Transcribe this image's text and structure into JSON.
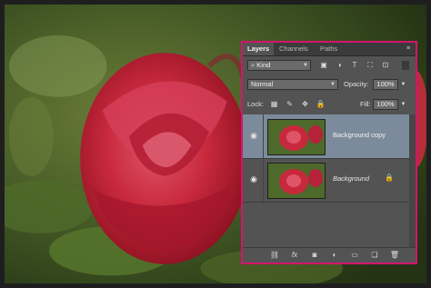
{
  "panel": {
    "tabs": [
      "Layers",
      "Channels",
      "Paths"
    ],
    "active_tab": "Layers",
    "menu_icon": "panel-menu-icon"
  },
  "filter": {
    "kind_label": "Kind",
    "icons": [
      "image-filter-icon",
      "adjustment-filter-icon",
      "type-filter-icon",
      "shape-filter-icon",
      "smart-object-filter-icon"
    ]
  },
  "blend": {
    "mode": "Normal",
    "opacity_label": "Opacity:",
    "opacity_value": "100%"
  },
  "lock": {
    "label": "Lock:",
    "fill_label": "Fill:",
    "fill_value": "100%"
  },
  "layers": [
    {
      "name": "Background copy",
      "selected": true,
      "italic": false,
      "locked": false
    },
    {
      "name": "Background",
      "selected": false,
      "italic": true,
      "locked": true
    }
  ],
  "bottom_icons": [
    "link-layers-icon",
    "fx-icon",
    "layer-mask-icon",
    "adjustment-layer-icon",
    "new-group-icon",
    "new-layer-icon",
    "delete-layer-icon"
  ],
  "colors": {
    "panel_bg": "#535353",
    "selected_row": "#7c8b9b",
    "highlight_border": "#d4146e",
    "rose": "#c8283c"
  }
}
